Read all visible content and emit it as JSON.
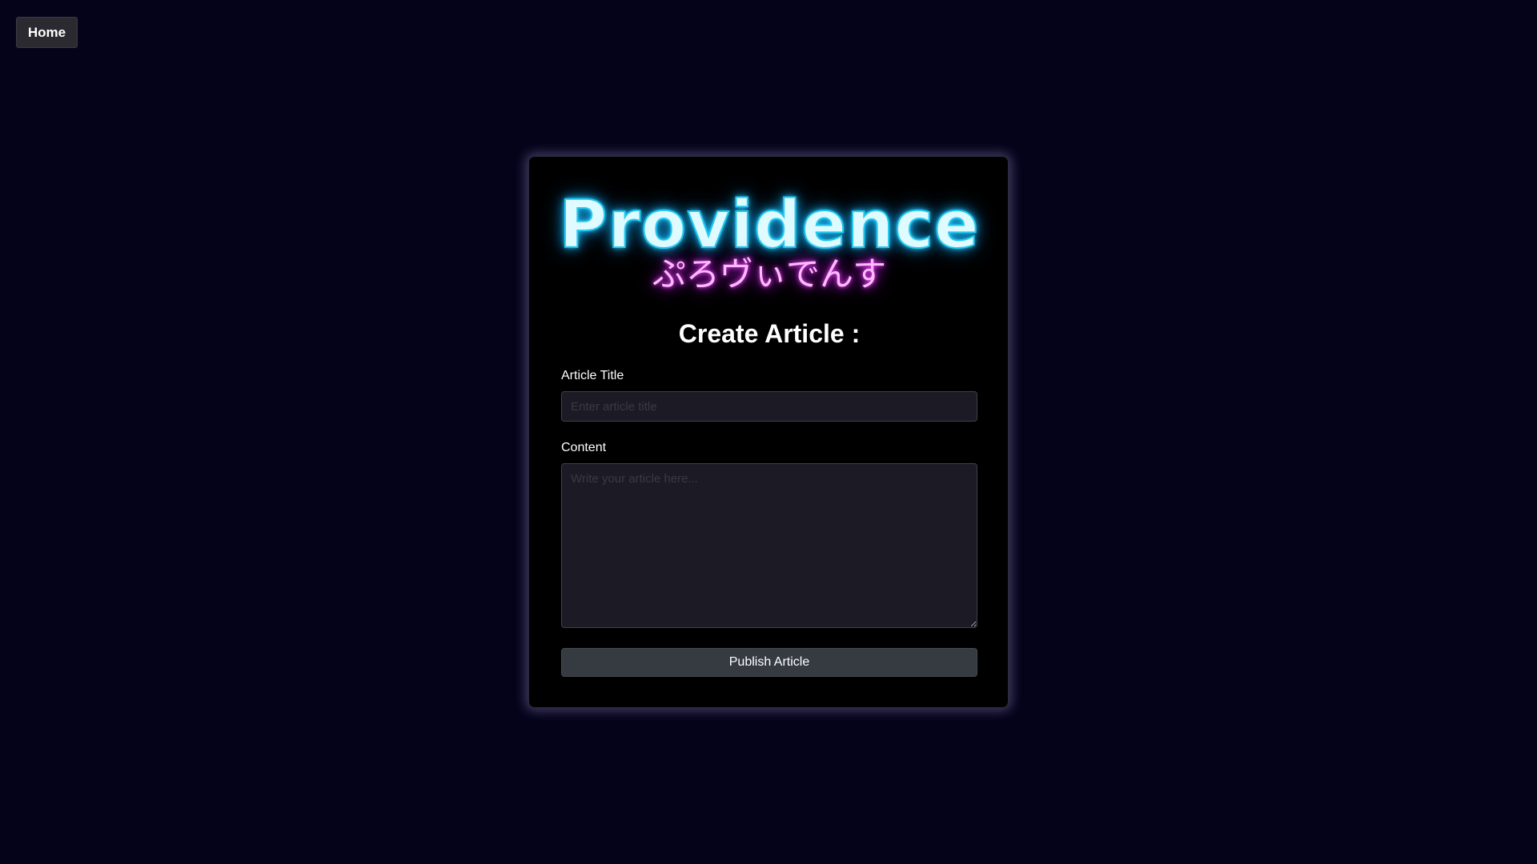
{
  "nav": {
    "home_label": "Home"
  },
  "logo": {
    "main": "Providence",
    "sub": "ぷろヴぃでんす"
  },
  "form": {
    "title": "Create Article :",
    "title_field": {
      "label": "Article Title",
      "placeholder": "Enter article title",
      "value": ""
    },
    "content_field": {
      "label": "Content",
      "placeholder": "Write your article here...",
      "value": ""
    },
    "submit_label": "Publish Article"
  },
  "colors": {
    "background": "#05031a",
    "card": "#000000",
    "logo_cyan": "#22c8f0",
    "logo_magenta": "#ff4cff",
    "field_bg": "#1b1a25",
    "button_bg": "#363b42"
  }
}
